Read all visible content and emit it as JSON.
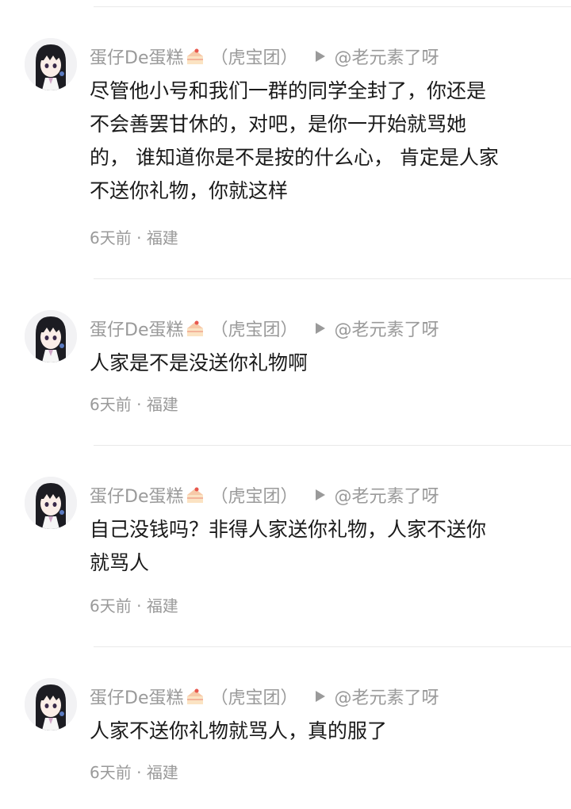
{
  "comments": [
    {
      "username": "蛋仔De蛋糕",
      "team": "（虎宝团）",
      "reply_to": "@老元素了呀",
      "text": "尽管他小号和我们一群的同学全封了，你还是\n不会善罢甘休的，对吧，是你一开始就骂她\n的， 谁知道你是不是按的什么心， 肯定是人家\n不送你礼物，你就这样",
      "time": "6天前",
      "location": "福建"
    },
    {
      "username": "蛋仔De蛋糕",
      "team": "（虎宝团）",
      "reply_to": "@老元素了呀",
      "text": "人家是不是没送你礼物啊",
      "time": "6天前",
      "location": "福建"
    },
    {
      "username": "蛋仔De蛋糕",
      "team": "（虎宝团）",
      "reply_to": "@老元素了呀",
      "text": "自己没钱吗？非得人家送你礼物，人家不送你\n就骂人",
      "time": "6天前",
      "location": "福建"
    },
    {
      "username": "蛋仔De蛋糕",
      "team": "（虎宝团）",
      "reply_to": "@老元素了呀",
      "text": "人家不送你礼物就骂人，真的服了",
      "time": "6天前",
      "location": "福建"
    }
  ],
  "meta_separator": "·",
  "icons": {
    "avatar": "anime-girl-avatar",
    "badge": "cake-icon",
    "reply": "reply-arrow-icon"
  },
  "colors": {
    "text_primary": "#1a1a1a",
    "text_secondary": "#9a9a9a",
    "divider": "#e9e9e9"
  }
}
